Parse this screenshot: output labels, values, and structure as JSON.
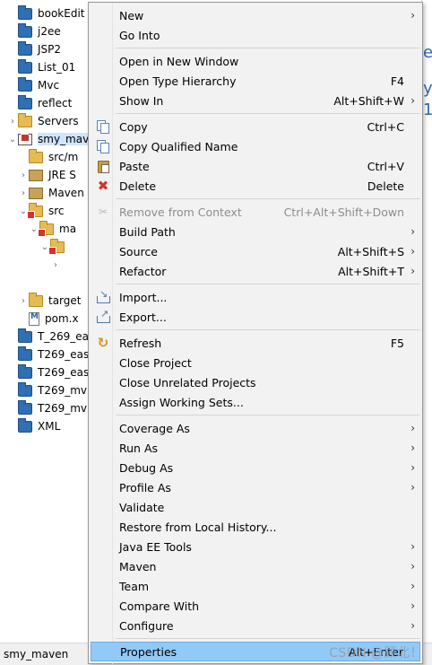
{
  "explorer": {
    "items": [
      {
        "label": "bookEdit",
        "kind": "project",
        "arrow": ""
      },
      {
        "label": "j2ee",
        "kind": "project",
        "arrow": ""
      },
      {
        "label": "JSP2",
        "kind": "project",
        "arrow": ""
      },
      {
        "label": "List_01",
        "kind": "project",
        "arrow": ""
      },
      {
        "label": "Mvc",
        "kind": "project",
        "arrow": ""
      },
      {
        "label": "reflect",
        "kind": "project",
        "arrow": ""
      },
      {
        "label": "Servers",
        "kind": "folder",
        "arrow": "›"
      },
      {
        "label": "smy_mav",
        "kind": "mvn",
        "arrow": "⌄"
      },
      {
        "label": "src/m",
        "kind": "folder",
        "arrow": ""
      },
      {
        "label": "JRE S",
        "kind": "jar",
        "arrow": "›"
      },
      {
        "label": "Maven",
        "kind": "jar",
        "arrow": "›"
      },
      {
        "label": "src",
        "kind": "folder-err",
        "arrow": "⌄"
      },
      {
        "label": "ma",
        "kind": "folder-err",
        "arrow": "⌄"
      },
      {
        "label": "",
        "kind": "folder-err",
        "arrow": "⌄"
      },
      {
        "label": "",
        "kind": "none",
        "arrow": "›"
      },
      {
        "label": "",
        "kind": "none",
        "arrow": ""
      },
      {
        "label": "target",
        "kind": "folder",
        "arrow": "›"
      },
      {
        "label": "pom.x",
        "kind": "file",
        "arrow": ""
      },
      {
        "label": "T_269_ea",
        "kind": "project",
        "arrow": ""
      },
      {
        "label": "T269_eas",
        "kind": "project",
        "arrow": ""
      },
      {
        "label": "T269_eas",
        "kind": "project",
        "arrow": ""
      },
      {
        "label": "T269_mv",
        "kind": "project",
        "arrow": ""
      },
      {
        "label": "T269_mv",
        "kind": "project",
        "arrow": ""
      },
      {
        "label": "XML",
        "kind": "project",
        "arrow": ""
      }
    ]
  },
  "editor_glyphs": [
    "e",
    "y",
    "1"
  ],
  "status": {
    "text": "smy_maven"
  },
  "watermark": "CSDN @顾北！",
  "menu": {
    "items": [
      {
        "label": "New",
        "shortcut": "",
        "submenu": true,
        "icon": "",
        "disabled": false
      },
      {
        "label": "Go Into",
        "shortcut": "",
        "submenu": false,
        "icon": "",
        "disabled": false
      },
      {
        "sep": true
      },
      {
        "label": "Open in New Window",
        "shortcut": "",
        "submenu": false,
        "icon": "",
        "disabled": false
      },
      {
        "label": "Open Type Hierarchy",
        "shortcut": "F4",
        "submenu": false,
        "icon": "",
        "disabled": false
      },
      {
        "label": "Show In",
        "shortcut": "Alt+Shift+W",
        "submenu": true,
        "icon": "",
        "disabled": false
      },
      {
        "sep": true
      },
      {
        "label": "Copy",
        "shortcut": "Ctrl+C",
        "submenu": false,
        "icon": "copy",
        "disabled": false
      },
      {
        "label": "Copy Qualified Name",
        "shortcut": "",
        "submenu": false,
        "icon": "cqn",
        "disabled": false
      },
      {
        "label": "Paste",
        "shortcut": "Ctrl+V",
        "submenu": false,
        "icon": "paste",
        "disabled": false
      },
      {
        "label": "Delete",
        "shortcut": "Delete",
        "submenu": false,
        "icon": "delete",
        "disabled": false
      },
      {
        "sep": true
      },
      {
        "label": "Remove from Context",
        "shortcut": "Ctrl+Alt+Shift+Down",
        "submenu": false,
        "icon": "remove",
        "disabled": true
      },
      {
        "label": "Build Path",
        "shortcut": "",
        "submenu": true,
        "icon": "",
        "disabled": false
      },
      {
        "label": "Source",
        "shortcut": "Alt+Shift+S",
        "submenu": true,
        "icon": "",
        "disabled": false
      },
      {
        "label": "Refactor",
        "shortcut": "Alt+Shift+T",
        "submenu": true,
        "icon": "",
        "disabled": false
      },
      {
        "sep": true
      },
      {
        "label": "Import...",
        "shortcut": "",
        "submenu": false,
        "icon": "import",
        "disabled": false
      },
      {
        "label": "Export...",
        "shortcut": "",
        "submenu": false,
        "icon": "export",
        "disabled": false
      },
      {
        "sep": true
      },
      {
        "label": "Refresh",
        "shortcut": "F5",
        "submenu": false,
        "icon": "refresh",
        "disabled": false
      },
      {
        "label": "Close Project",
        "shortcut": "",
        "submenu": false,
        "icon": "",
        "disabled": false
      },
      {
        "label": "Close Unrelated Projects",
        "shortcut": "",
        "submenu": false,
        "icon": "",
        "disabled": false
      },
      {
        "label": "Assign Working Sets...",
        "shortcut": "",
        "submenu": false,
        "icon": "",
        "disabled": false
      },
      {
        "sep": true
      },
      {
        "label": "Coverage As",
        "shortcut": "",
        "submenu": true,
        "icon": "",
        "disabled": false
      },
      {
        "label": "Run As",
        "shortcut": "",
        "submenu": true,
        "icon": "",
        "disabled": false
      },
      {
        "label": "Debug As",
        "shortcut": "",
        "submenu": true,
        "icon": "",
        "disabled": false
      },
      {
        "label": "Profile As",
        "shortcut": "",
        "submenu": true,
        "icon": "",
        "disabled": false
      },
      {
        "label": "Validate",
        "shortcut": "",
        "submenu": false,
        "icon": "",
        "disabled": false
      },
      {
        "label": "Restore from Local History...",
        "shortcut": "",
        "submenu": false,
        "icon": "",
        "disabled": false
      },
      {
        "label": "Java EE Tools",
        "shortcut": "",
        "submenu": true,
        "icon": "",
        "disabled": false
      },
      {
        "label": "Maven",
        "shortcut": "",
        "submenu": true,
        "icon": "",
        "disabled": false
      },
      {
        "label": "Team",
        "shortcut": "",
        "submenu": true,
        "icon": "",
        "disabled": false
      },
      {
        "label": "Compare With",
        "shortcut": "",
        "submenu": true,
        "icon": "",
        "disabled": false
      },
      {
        "label": "Configure",
        "shortcut": "",
        "submenu": true,
        "icon": "",
        "disabled": false
      },
      {
        "sep": true
      },
      {
        "label": "Properties",
        "shortcut": "Alt+Enter",
        "submenu": false,
        "icon": "",
        "disabled": false,
        "highlighted": true
      }
    ]
  }
}
